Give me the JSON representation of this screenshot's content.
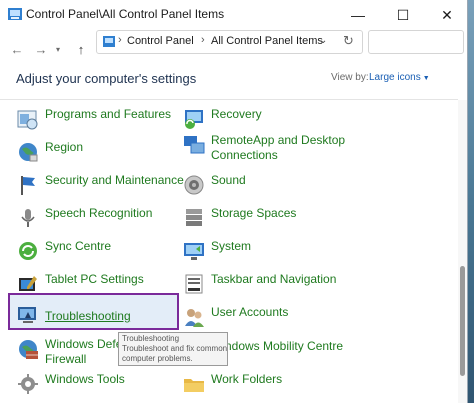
{
  "window": {
    "title": "Control Panel\\All Control Panel Items",
    "controls": {
      "minimize": "—",
      "maximize": "☐",
      "close": "✕"
    }
  },
  "nav": {
    "back": "←",
    "forward": "→",
    "recent": "▾",
    "up": "↑",
    "breadcrumbs": [
      "Control Panel",
      "All Control Panel Items"
    ],
    "separator": "›",
    "address_dropdown": "⌄",
    "refresh": "↻",
    "search_value": ""
  },
  "content": {
    "heading": "Adjust your computer's settings",
    "view_by_label": "View by:",
    "view_by_value": "Large icons"
  },
  "items_left": [
    {
      "label": "Programs and Features",
      "icon": "programs-features-icon"
    },
    {
      "label": "Region",
      "icon": "globe-icon"
    },
    {
      "label": "Security and Maintenance",
      "icon": "flag-icon"
    },
    {
      "label": "Speech Recognition",
      "icon": "microphone-icon"
    },
    {
      "label": "Sync Centre",
      "icon": "sync-icon"
    },
    {
      "label": "Tablet PC Settings",
      "icon": "tablet-icon"
    },
    {
      "label": "Troubleshooting",
      "icon": "troubleshooting-icon"
    },
    {
      "label": "Windows Defender",
      "label2": "Firewall",
      "icon": "firewall-icon"
    },
    {
      "label": "Windows Tools",
      "icon": "gear-icon"
    }
  ],
  "items_right": [
    {
      "label": "Recovery",
      "icon": "recovery-icon"
    },
    {
      "label": "RemoteApp and Desktop",
      "label2": "Connections",
      "icon": "remote-desktop-icon"
    },
    {
      "label": "Sound",
      "icon": "speaker-icon"
    },
    {
      "label": "Storage Spaces",
      "icon": "storage-icon"
    },
    {
      "label": "System",
      "icon": "system-icon"
    },
    {
      "label": "Taskbar and Navigation",
      "icon": "taskbar-icon"
    },
    {
      "label": "User Accounts",
      "icon": "users-icon"
    },
    {
      "label": "Windows Mobility Centre",
      "icon": "mobility-icon"
    },
    {
      "label": "Work Folders",
      "icon": "folder-icon"
    }
  ],
  "tooltip": {
    "title": "Troubleshooting",
    "line1": "Troubleshoot and fix common",
    "line2": "computer problems."
  },
  "colors": {
    "link_green": "#1f7a1f",
    "highlight_border": "#7a2a9a",
    "highlight_fill": "#e3edf8"
  }
}
